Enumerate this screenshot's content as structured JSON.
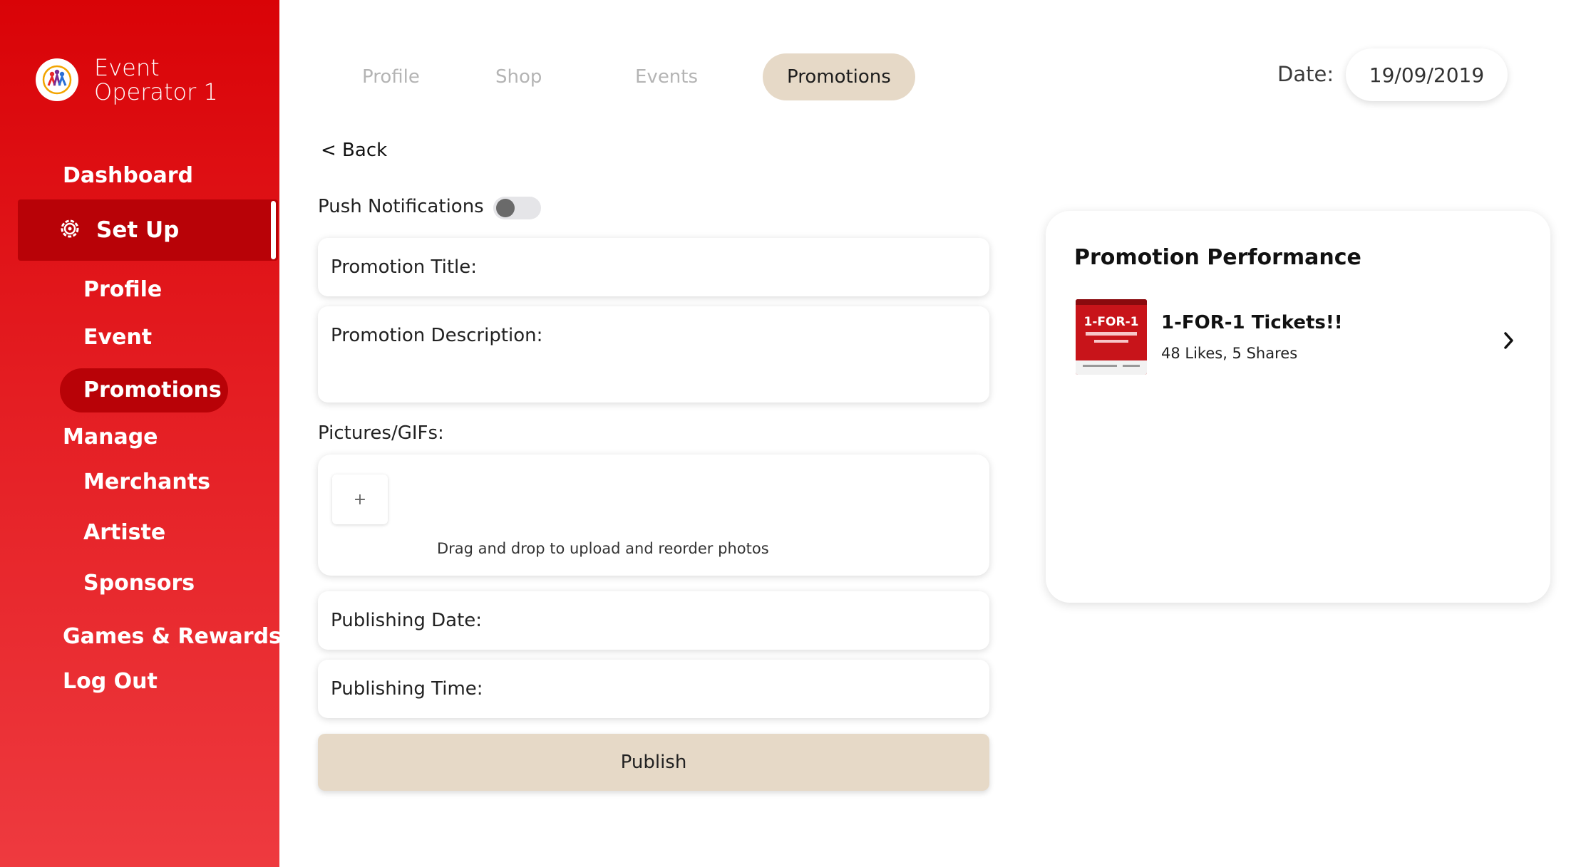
{
  "sidebar": {
    "brand_line1": "Event",
    "brand_line2": "Operator 1",
    "dashboard": "Dashboard",
    "setup": "Set Up",
    "profile": "Profile",
    "event": "Event",
    "promotions": "Promotions",
    "manage": "Manage",
    "merchants": "Merchants",
    "artiste": "Artiste",
    "sponsors": "Sponsors",
    "games_rewards": "Games & Rewards",
    "logout": "Log Out"
  },
  "tabs": [
    {
      "label": "Profile",
      "active": false
    },
    {
      "label": "Shop",
      "active": false
    },
    {
      "label": "Events",
      "active": false
    },
    {
      "label": "Promotions",
      "active": true
    }
  ],
  "date": {
    "label": "Date:",
    "value": "19/09/2019"
  },
  "form": {
    "back": "< Back",
    "push_notifications": "Push Notifications",
    "push_enabled": false,
    "promotion_title": "Promotion Title:",
    "promotion_description": "Promotion Description:",
    "pictures_label": "Pictures/GIFs:",
    "add_symbol": "+",
    "upload_hint": "Drag and drop to upload and reorder photos",
    "publishing_date": "Publishing Date:",
    "publishing_time": "Publishing Time:",
    "publish": "Publish"
  },
  "performance": {
    "title": "Promotion Performance",
    "items": [
      {
        "title": "1-FOR-1 Tickets!!",
        "stats": "48 Likes, 5 Shares",
        "thumb_text": "1-FOR-1"
      }
    ]
  },
  "colors": {
    "accent_red": "#d90307",
    "active_red": "#b80207",
    "beige": "#e6d9c7"
  }
}
